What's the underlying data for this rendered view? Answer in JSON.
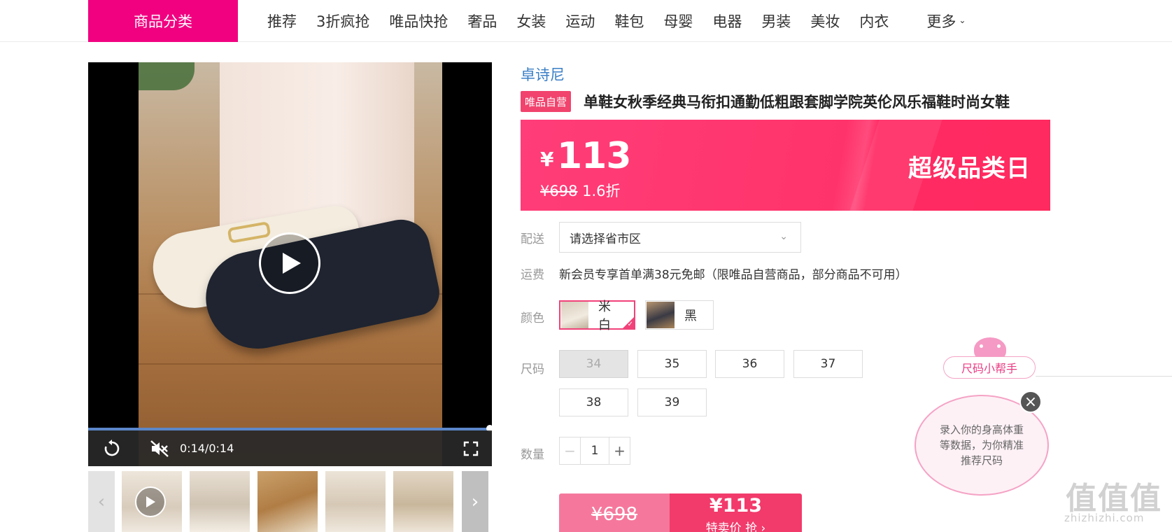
{
  "nav": {
    "category_button": "商品分类",
    "items": [
      "推荐",
      "3折疯抢",
      "唯品快抢",
      "奢品",
      "女装",
      "运动",
      "鞋包",
      "母婴",
      "电器",
      "男装",
      "美妆",
      "内衣"
    ],
    "more": "更多"
  },
  "video": {
    "time": "0:14/0:14",
    "progress": 1.0,
    "icons": [
      "replay-icon",
      "mute-icon",
      "fullscreen-icon",
      "play-icon"
    ]
  },
  "product": {
    "brand": "卓诗尼",
    "self_badge": "唯品自营",
    "title": "单鞋女秋季经典马衔扣通勤低粗跟套脚学院英伦风乐福鞋时尚女鞋",
    "price_symbol": "¥",
    "price": "113",
    "original_price": "¥698",
    "discount": "1.6折",
    "promo_tag": "超级品类日"
  },
  "delivery": {
    "label": "配送",
    "placeholder": "请选择省市区"
  },
  "shipping": {
    "label": "运费",
    "text": "新会员专享首单满38元免邮（限唯品自营商品，部分商品不可用）"
  },
  "color": {
    "label": "颜色",
    "options": [
      {
        "name": "米白",
        "selected": true
      },
      {
        "name": "黑",
        "selected": false
      }
    ]
  },
  "size": {
    "label": "尺码",
    "options": [
      {
        "value": "34",
        "disabled": true
      },
      {
        "value": "35",
        "disabled": false
      },
      {
        "value": "36",
        "disabled": false
      },
      {
        "value": "37",
        "disabled": false
      },
      {
        "value": "38",
        "disabled": false
      },
      {
        "value": "39",
        "disabled": false
      }
    ]
  },
  "quantity": {
    "label": "数量",
    "value": "1",
    "minus": "−",
    "plus": "+"
  },
  "buy": {
    "original": "¥698",
    "price": "¥113",
    "cta": "特卖价 抢 ›"
  },
  "size_helper": {
    "button": "尺码小帮手",
    "bubble": "录入你的身高体重等数据，为你精准推荐尺码"
  },
  "watermark": {
    "main": "值值值",
    "sub": "zhizhizhi.com"
  },
  "colors": {
    "brand_pink": "#f10180",
    "price_red": "#ff336b",
    "link_blue": "#3a7fc7"
  }
}
